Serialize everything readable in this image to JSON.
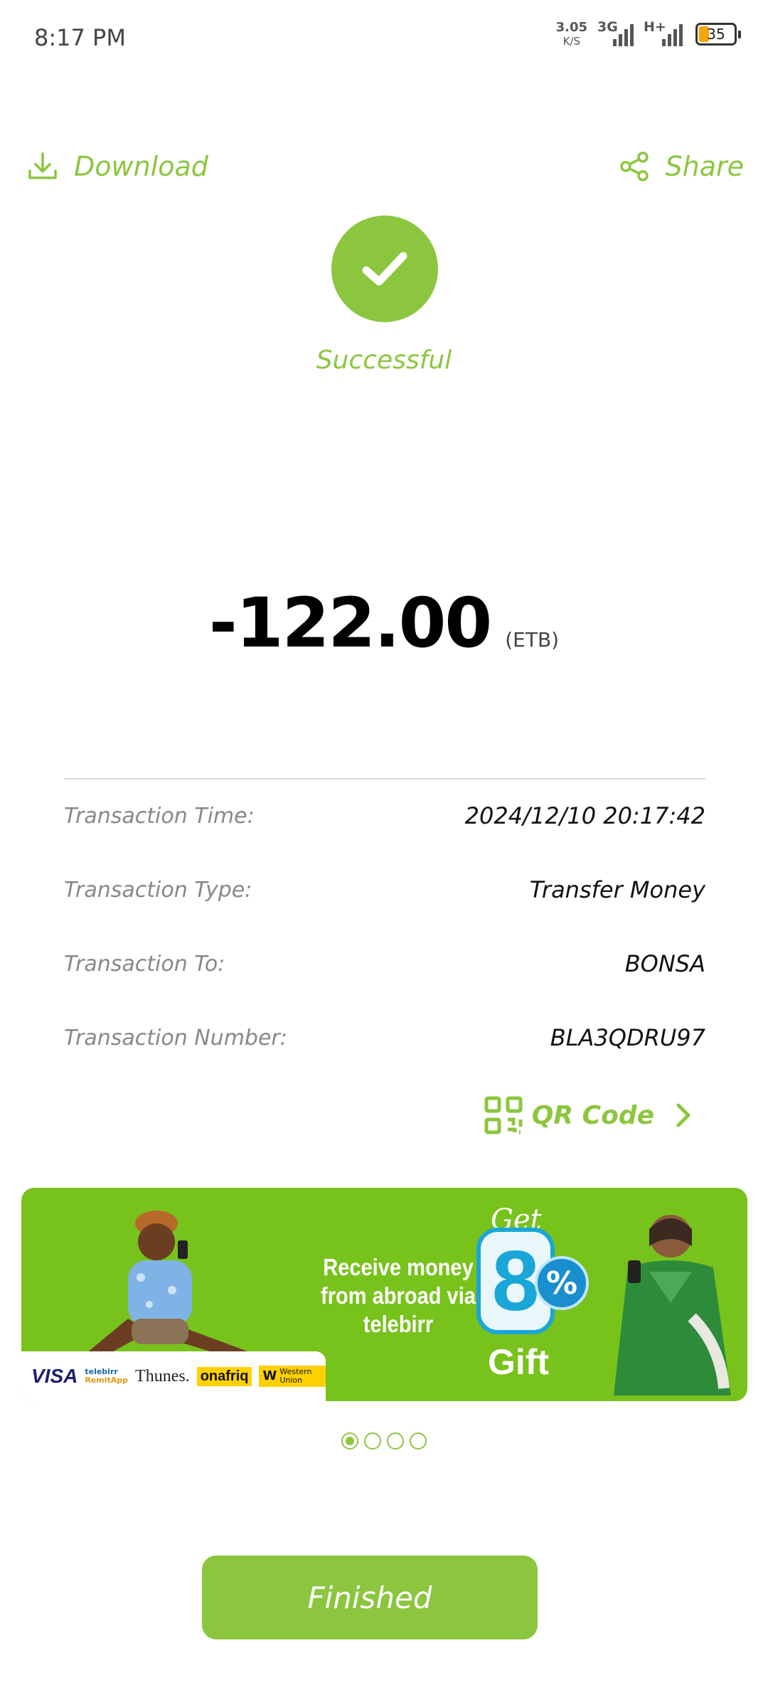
{
  "status_bar": {
    "time": "8:17 PM",
    "net_speed_value": "3.05",
    "net_speed_unit": "K/S",
    "signal1_label": "3G",
    "signal2_label": "H+",
    "battery_level": "35"
  },
  "header": {
    "download_label": "Download",
    "share_label": "Share"
  },
  "result": {
    "status": "Successful",
    "amount": "-122.00",
    "currency": "(ETB)"
  },
  "details": [
    {
      "label": "Transaction Time:",
      "value": "2024/12/10 20:17:42"
    },
    {
      "label": "Transaction Type:",
      "value": "Transfer Money"
    },
    {
      "label": "Transaction To:",
      "value": "BONSA"
    },
    {
      "label": "Transaction Number:",
      "value": "BLA3QDRU97"
    }
  ],
  "qr_link_label": "QR Code",
  "banner": {
    "headline": "Receive money from abroad via telebirr",
    "get": "Get",
    "number": "8",
    "percent": "%",
    "gift": "Gift",
    "partners": {
      "visa": "VISA",
      "remit_brand": "telebirr",
      "remit_app": "RemitApp",
      "thunes": "Thunes.",
      "onafriq": "onafriq",
      "western_union": "Western Union"
    },
    "page_count": 4,
    "active_page": 1
  },
  "finish_button_label": "Finished",
  "colors": {
    "accent": "#8cc63f",
    "banner_bg": "#78c21c",
    "battery_fill": "#f5a500"
  }
}
